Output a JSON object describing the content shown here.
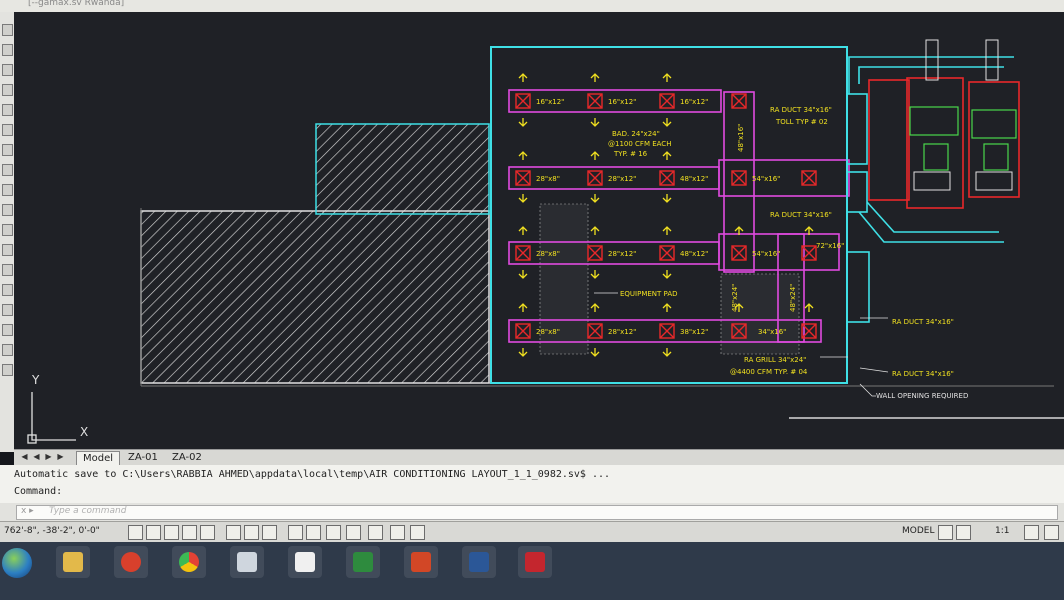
{
  "window": {
    "title_fragment": "[--gamax.sv Rwanda]"
  },
  "drawing": {
    "labels": {
      "bad": "BAD. 24\"x24\"",
      "bad_cfm": "@1100 CFM EACH",
      "bad_typ": "TYP. # 16",
      "ra_duct_top": "RA DUCT 34\"x16\"",
      "ra_duct_top2": "TOLL TYP # 02",
      "ra_duct_mid": "RA DUCT 34\"x16\"",
      "equipment_pad": "EQUIPMENT PAD",
      "ra_grill": "RA GRILL 34\"x24\"",
      "ra_grill_cfm": "@4400 CFM TYP. # 04",
      "ra_duct_right1": "RA DUCT 34\"x16\"",
      "ra_duct_right2": "RA DUCT 34\"x16\"",
      "wall_opening": "WALL OPENING REQUIRED",
      "row1": [
        "16\"x12\"",
        "16\"x12\"",
        "16\"x12\""
      ],
      "row2": [
        "28\"x8\"",
        "28\"x12\"",
        "48\"x12\"",
        "54\"x16\""
      ],
      "row3": [
        "28\"x8\"",
        "28\"x12\"",
        "48\"x12\"",
        "54\"x16\"",
        "72\"x16\""
      ],
      "row4": [
        "28\"x8\"",
        "28\"x12\"",
        "38\"x12\"",
        "34\"x16\""
      ],
      "vert": [
        "48\"x16\"",
        "48\"x24\"",
        "48\"x24\""
      ]
    },
    "ucs": {
      "x": "X",
      "y": "Y"
    }
  },
  "tabs": {
    "model": "Model",
    "za01": "ZA-01",
    "za02": "ZA-02"
  },
  "command": {
    "history": "Automatic save to C:\\Users\\RABBIA AHMED\\appdata\\local\\temp\\AIR CONDITIONING LAYOUT_1_1_0982.sv$ ...",
    "prompt": "Command:",
    "input_placeholder": "Type a command",
    "input_prompt_icon": "x ▸"
  },
  "status": {
    "coords": "762'-8\", -38'-2\", 0'-0\"",
    "model": "MODEL",
    "scale": "1:1"
  },
  "taskbar": {
    "apps": [
      "start",
      "explorer",
      "media-player",
      "chrome",
      "file-manager",
      "sync",
      "excel",
      "powerpoint",
      "word",
      "autocad"
    ]
  },
  "colors": {
    "background": "#1f2126",
    "cyan": "#3fe0e6",
    "magenta": "#e04ae0",
    "yellow": "#f0e020",
    "red": "#e8282a",
    "green": "#4ad84a",
    "hatch": "#d8d8d8"
  }
}
